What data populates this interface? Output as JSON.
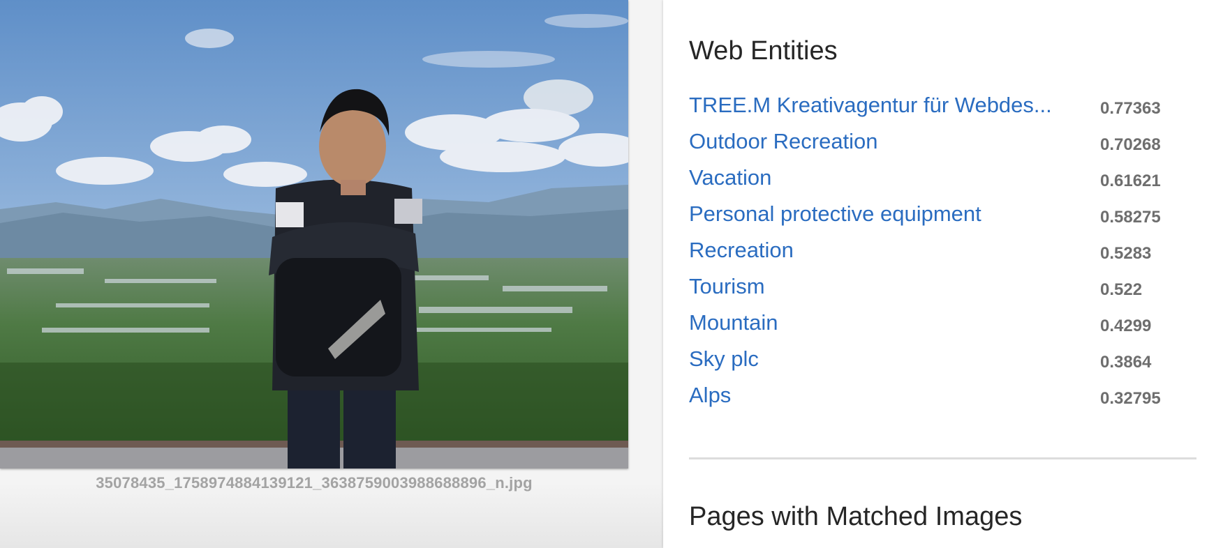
{
  "image": {
    "filename": "35078435_1758974884139121_3638759003988688896_n.jpg"
  },
  "web_entities": {
    "title": "Web Entities",
    "items": [
      {
        "name": "TREE.M Kreativagentur für Webdes...",
        "score": "0.77363"
      },
      {
        "name": "Outdoor Recreation",
        "score": "0.70268"
      },
      {
        "name": "Vacation",
        "score": "0.61621"
      },
      {
        "name": "Personal protective equipment",
        "score": "0.58275"
      },
      {
        "name": "Recreation",
        "score": "0.5283"
      },
      {
        "name": "Tourism",
        "score": "0.522"
      },
      {
        "name": "Mountain",
        "score": "0.4299"
      },
      {
        "name": "Sky plc",
        "score": "0.3864"
      },
      {
        "name": "Alps",
        "score": "0.32795"
      }
    ]
  },
  "pages_with_matched_images": {
    "title": "Pages with Matched Images"
  },
  "colors": {
    "link": "#2a6cc0",
    "score": "#6e6e6e",
    "title": "#262626",
    "filename": "#a3a3a3"
  }
}
